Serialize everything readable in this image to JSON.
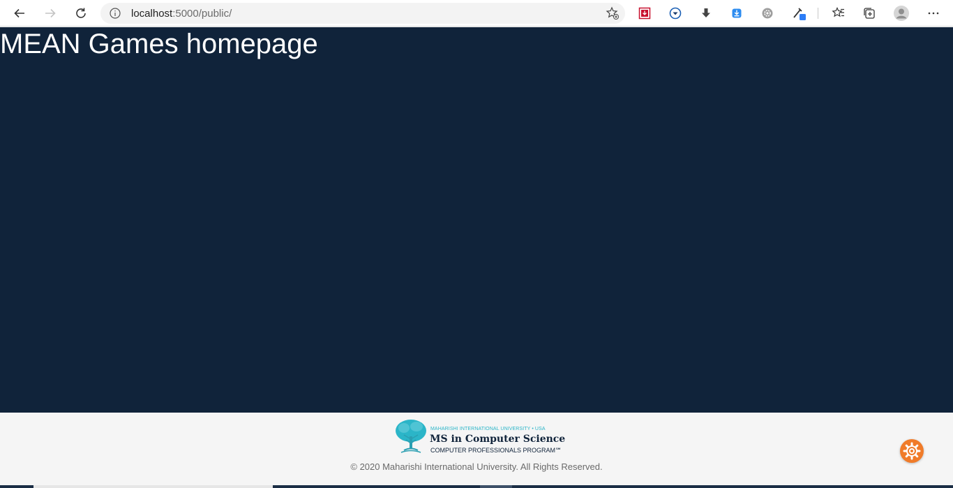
{
  "browser": {
    "url_host": "localhost",
    "url_path": ":5000/public/"
  },
  "page": {
    "title": "MEAN Games homepage"
  },
  "footer": {
    "logo_line1": "MAHARISHI INTERNATIONAL UNIVERSITY • USA",
    "logo_line2": "MS in Computer Science",
    "logo_line3": "COMPUTER PROFESSIONALS PROGRAM℠",
    "copyright": "© 2020 Maharishi International University. All Rights Reserved."
  },
  "colors": {
    "page_background": "#10233a",
    "footer_background": "#f5f5f5",
    "accent_orange": "#f07b29",
    "logo_teal": "#2bb5c8"
  },
  "icons": {
    "back": "back-arrow-icon",
    "forward": "forward-arrow-icon",
    "reload": "reload-icon",
    "site_info": "info-icon",
    "add_favorite": "add-favorite-icon",
    "extensions": [
      "pdf-extension-icon",
      "video-download-icon",
      "download-icon",
      "downloader-extension-icon",
      "settings-extension-icon",
      "color-picker-icon"
    ],
    "favorites": "favorites-icon",
    "collections": "collections-icon",
    "profile": "profile-avatar-icon",
    "menu": "more-menu-icon",
    "floating": "gear-icon"
  }
}
